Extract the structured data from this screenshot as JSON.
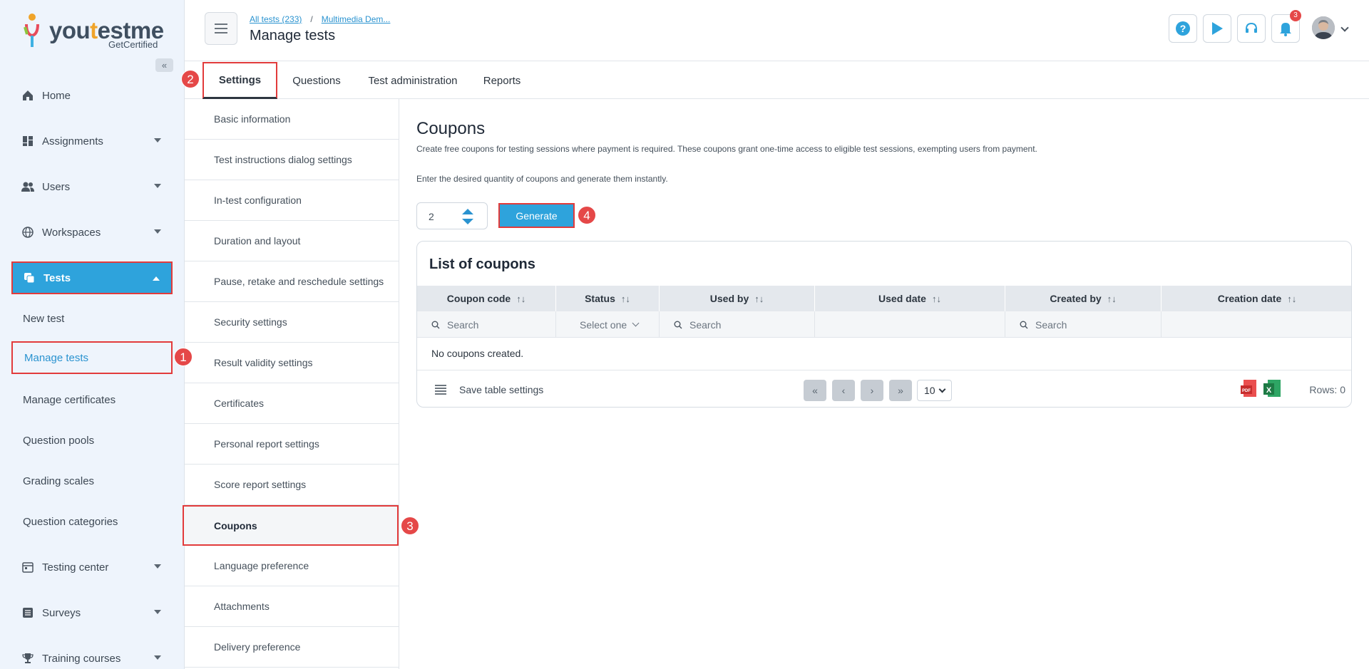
{
  "brand": {
    "word_a": "you",
    "word_b": "t",
    "word_c": "estme",
    "sub": "GetCertified"
  },
  "sidebar": {
    "items": [
      {
        "label": "Home",
        "icon": "home-icon"
      },
      {
        "label": "Assignments",
        "icon": "dashboard-icon"
      },
      {
        "label": "Users",
        "icon": "users-icon"
      },
      {
        "label": "Workspaces",
        "icon": "globe-icon"
      },
      {
        "label": "Tests",
        "icon": "copy-icon"
      },
      {
        "label": "Testing center",
        "icon": "calendar-icon"
      },
      {
        "label": "Surveys",
        "icon": "list-icon"
      },
      {
        "label": "Training courses",
        "icon": "trophy-icon"
      }
    ],
    "sub_items": [
      {
        "label": "New test"
      },
      {
        "label": "Manage tests"
      },
      {
        "label": "Manage certificates"
      },
      {
        "label": "Question pools"
      },
      {
        "label": "Grading scales"
      },
      {
        "label": "Question categories"
      }
    ]
  },
  "header": {
    "breadcrumb_all": "All tests (233)",
    "breadcrumb_sep": "/",
    "breadcrumb_current": "Multimedia Dem...",
    "title": "Manage tests",
    "notification_count": "3"
  },
  "tabs": [
    {
      "label": "Settings"
    },
    {
      "label": "Questions"
    },
    {
      "label": "Test administration"
    },
    {
      "label": "Reports"
    }
  ],
  "settings_list": [
    "Basic information",
    "Test instructions dialog settings",
    "In-test configuration",
    "Duration and layout",
    "Pause, retake and reschedule settings",
    "Security settings",
    "Result validity settings",
    "Certificates",
    "Personal report settings",
    "Score report settings",
    "Coupons",
    "Language preference",
    "Attachments",
    "Delivery preference"
  ],
  "main": {
    "title": "Coupons",
    "desc1": "Create free coupons for testing sessions where payment is required. These coupons grant one-time access to eligible test sessions, exempting users from payment.",
    "desc2": "Enter the desired quantity of coupons and generate them instantly.",
    "quantity": "2",
    "generate_label": "Generate"
  },
  "table": {
    "title": "List of coupons",
    "columns": [
      "Coupon code",
      "Status",
      "Used by",
      "Used date",
      "Created by",
      "Creation date"
    ],
    "sort_glyph": "↑↓",
    "search_placeholder": "Search",
    "status_placeholder": "Select one",
    "empty_text": "No coupons created.",
    "save_settings": "Save table settings",
    "page_size": "10",
    "rows_text": "Rows: 0"
  },
  "annotations": [
    "1",
    "2",
    "3",
    "4"
  ],
  "colors": {
    "accent": "#2ea3dc",
    "highlight": "#e23b3b",
    "badge": "#e54848"
  }
}
